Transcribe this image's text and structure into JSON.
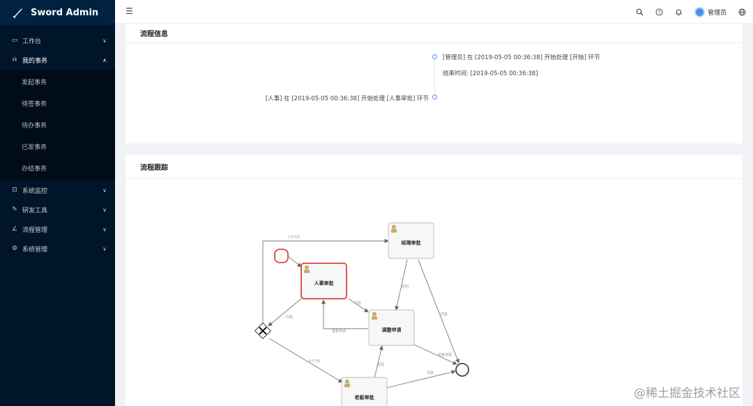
{
  "app": {
    "title": "Sword Admin"
  },
  "sidebar": {
    "items": [
      {
        "label": "工作台",
        "icon": "monitor-icon",
        "arrow": "∨"
      },
      {
        "label": "我的事务",
        "icon": "bell-icon",
        "arrow": "∧"
      },
      {
        "label": "系统监控",
        "icon": "chart-icon",
        "arrow": "∨"
      },
      {
        "label": "研发工具",
        "icon": "wrench-icon",
        "arrow": "∨"
      },
      {
        "label": "流程管理",
        "icon": "line-icon",
        "arrow": "∨"
      },
      {
        "label": "系统管理",
        "icon": "gear-icon",
        "arrow": "∨"
      }
    ],
    "sub_items": [
      "发起事务",
      "待签事务",
      "待办事务",
      "已发事务",
      "办结事务"
    ]
  },
  "header": {
    "user": "管理员"
  },
  "process_info": {
    "title": "流程信息",
    "entries": [
      {
        "text": "[管理员] 在 [2019-05-05 00:36:38] 开始处理 [开始] 环节"
      },
      {
        "text": "结束时间: [2019-05-05 00:36:38]"
      },
      {
        "text": "[人事] 在 [2019-05-05 00:36:38] 开始处理 [人事审批] 环节"
      }
    ]
  },
  "process_trace": {
    "title": "流程跟踪",
    "nodes": {
      "hr": "人事审批",
      "manager": "经理审批",
      "adjust": "调整申请",
      "boss": "老板审批"
    },
    "flow_labels": [
      "小于3天",
      "驳回",
      "同意",
      "重新申请",
      "同意",
      "大于3天",
      "驳回",
      "结束流程",
      "同意",
      "同意"
    ]
  },
  "watermark": "@稀土掘金技术社区"
}
